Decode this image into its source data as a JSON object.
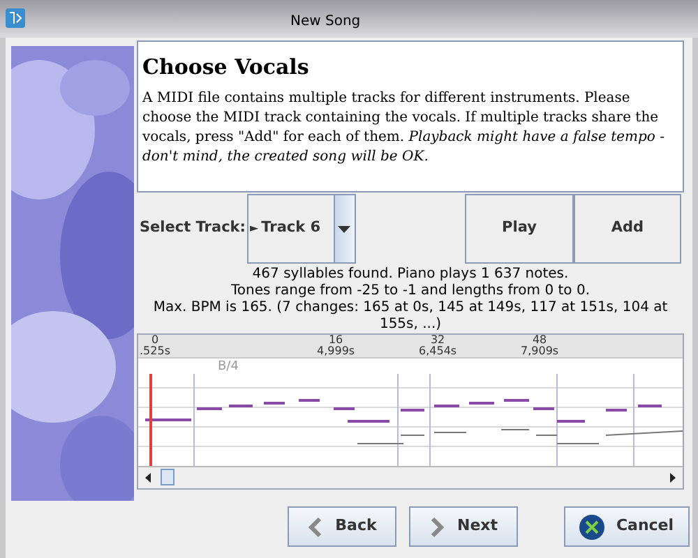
{
  "window": {
    "title": "New Song"
  },
  "heading": "Choose Vocals",
  "description": "A MIDI file contains multiple tracks for different instruments. Please choose the MIDI track containing the vocals. If multiple tracks share the vocals, press \"Add\" for each of them. *Playback might have a false tempo - don't mind, the created song will be OK.*",
  "track_select": {
    "label": "Select Track:",
    "marker": "►",
    "value": "Track 6"
  },
  "play_button": "Play",
  "add_button": "Add",
  "info_lines": [
    "467 syllables found. Piano plays 1 637 notes.",
    "Tones range from -25 to -1 and lengths from 0 to 0.",
    "Max. BPM is 165. (7 changes: 165 at 0s, 145 at 149s, 117 at 151s, 104 at 155s, ...)"
  ],
  "timeline": {
    "beats": [
      {
        "beat": "0",
        "time": ".525s"
      },
      {
        "beat": "16",
        "time": "4,999s"
      },
      {
        "beat": "32",
        "time": "6,454s"
      },
      {
        "beat": "48",
        "time": "7,909s"
      }
    ],
    "measure_label": "B/4"
  },
  "buttons": [
    {
      "kind": "back",
      "label": "Back"
    },
    {
      "kind": "next",
      "label": "Next"
    },
    {
      "kind": "cancel",
      "label": "Cancel"
    }
  ]
}
